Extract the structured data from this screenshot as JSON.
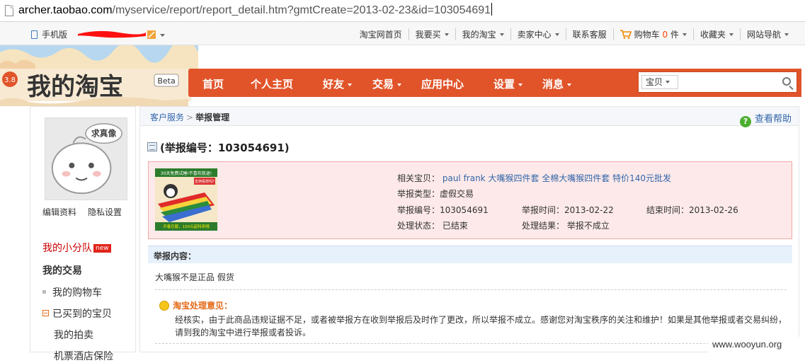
{
  "address_bar": {
    "domain": "archer.taobao.com",
    "path": "/myservice/report/report_detail.htm?gmtCreate=2013-02-23&id=103054691"
  },
  "top_bar": {
    "mobile_label": "手机版",
    "nav": [
      {
        "label": "淘宝网首页",
        "dropdown": false
      },
      {
        "label": "我要买",
        "dropdown": true
      },
      {
        "label": "我的淘宝",
        "dropdown": true
      },
      {
        "label": "卖家中心",
        "dropdown": true
      },
      {
        "label": "联系客服",
        "dropdown": false
      }
    ],
    "cart_label": "购物车",
    "cart_count": "0",
    "cart_unit": "件",
    "favorites_label": "收藏夹",
    "site_nav_label": "网站导航"
  },
  "logo": {
    "text": "我的淘宝",
    "badge": "Beta",
    "date_badge": "3.8"
  },
  "main_nav": [
    {
      "label": "首页",
      "dropdown": false
    },
    {
      "label": "个人主页",
      "dropdown": false
    },
    {
      "label": "好友",
      "dropdown": true
    },
    {
      "label": "交易",
      "dropdown": true
    },
    {
      "label": "应用中心",
      "dropdown": false
    },
    {
      "label": "设置",
      "dropdown": true
    },
    {
      "label": "消息",
      "dropdown": true
    }
  ],
  "search": {
    "scope": "宝贝",
    "placeholder": ""
  },
  "sidebar": {
    "avatar_text": "求真像",
    "edit_profile": "编辑资料",
    "privacy": "隐私设置",
    "group_label": "我的小分队",
    "new_badge": "new",
    "section_title": "我的交易",
    "items": [
      "我的购物车",
      "已买到的宝贝",
      "我的拍卖",
      "机票酒店保险"
    ]
  },
  "breadcrumb": {
    "parent": "客户服务",
    "current": "举报管理"
  },
  "help_label": "查看帮助",
  "report": {
    "title": "(举报编号：103054691)",
    "product_label": "相关宝贝：",
    "product_name": "paul frank 大嘴猴四件套 全棉大嘴猴四件套 特价140元批发",
    "type_label": "举报类型：",
    "type_value": "虚假交易",
    "id_label": "举报编号：",
    "id_value": "103054691",
    "time_label": "举报时间：",
    "time_value": "2013-02-22",
    "end_label": "结束时间：",
    "end_value": "2013-02-26",
    "status_label": "处理状态：",
    "status_value": "已结束",
    "result_label": "处理结果：",
    "result_value": "举报不成立",
    "product_img_caption_top": "30天免费试睡!不喜欢就退!",
    "product_img_caption_mid": "支持看样吗?",
    "product_img_caption_bottom": "开春巨献，150元起特卖哦"
  },
  "content": {
    "section_title": "举报内容：",
    "text": "大嘴猴不是正品 假货",
    "opinion_title": "淘宝处理意见：",
    "opinion_text": "经核实，由于此商品违规证据不足，或者被举报方在收到举报后及时作了更改，所以举报不成立。感谢您对淘宝秩序的关注和维护！如果是其他举报或者交易纠纷，请到我的淘宝中进行举报或者投诉。"
  },
  "watermark": "www.wooyun.org",
  "colors": {
    "nav_bg": "#e1542a",
    "info_bg": "#fde9e9",
    "link": "#3366aa",
    "accent": "#ff4400"
  }
}
